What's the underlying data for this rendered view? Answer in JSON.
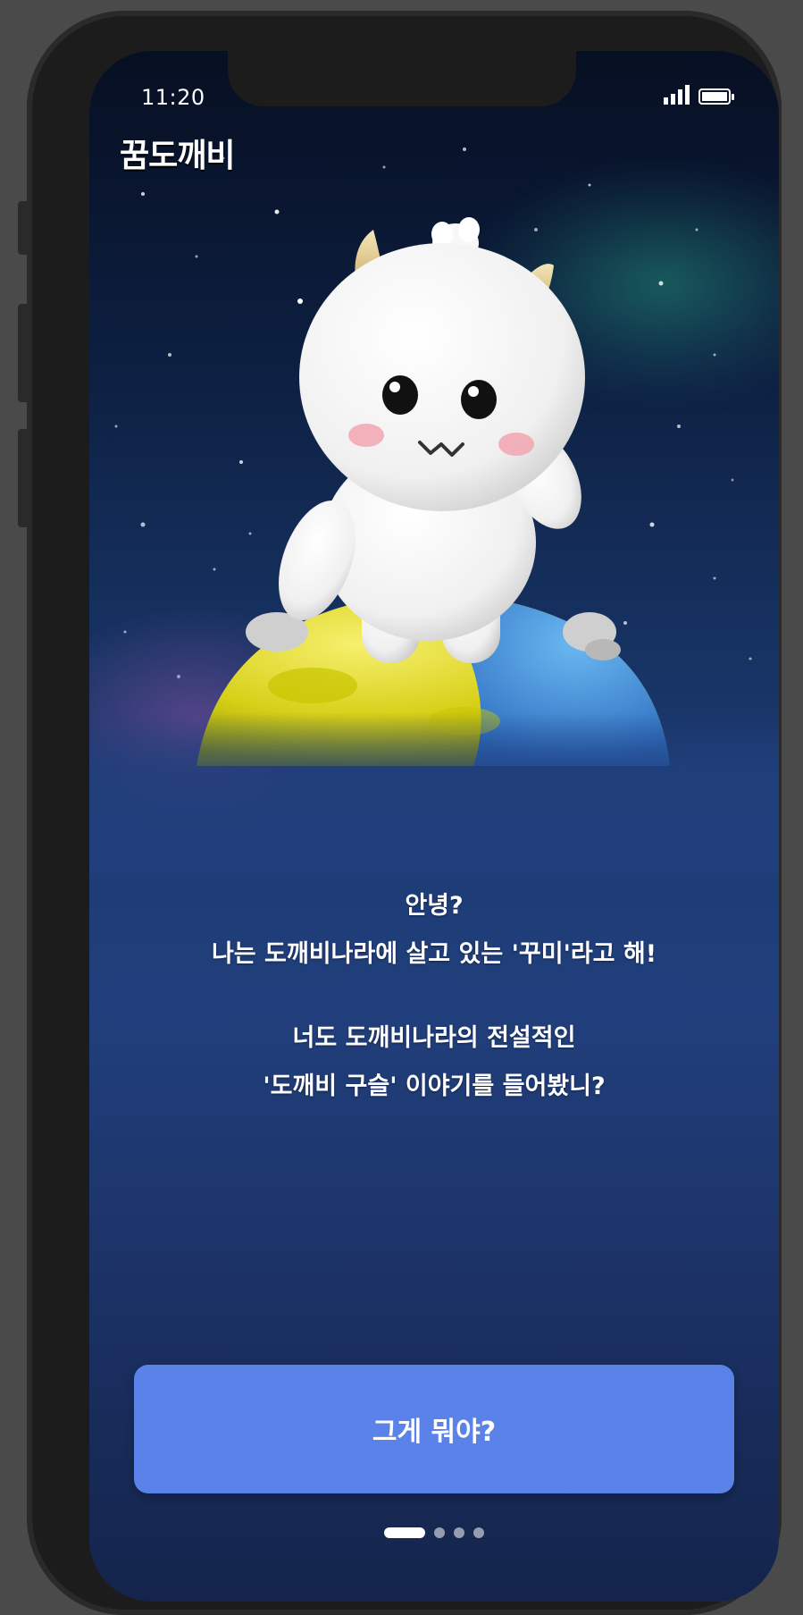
{
  "status_bar": {
    "time": "11:20"
  },
  "app": {
    "logo_text": "꿈도깨비"
  },
  "dialog": {
    "greeting": "안녕?",
    "intro": "나는 도깨비나라에 살고 있는 '꾸미'라고 해!",
    "question_line1": "너도 도깨비나라의 전설적인",
    "question_line2": "'도깨비 구슬' 이야기를 들어봤니?"
  },
  "cta": {
    "label": "그게 뭐야?"
  },
  "pagination": {
    "total": 4,
    "current": 1
  },
  "colors": {
    "button": "#5a82e9",
    "background_top": "#070f22",
    "background_mid": "#1c3a72"
  },
  "icons": [
    "signal-icon",
    "battery-icon"
  ]
}
